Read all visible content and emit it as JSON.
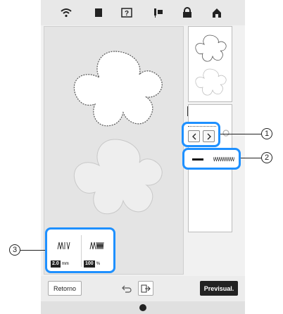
{
  "topbar": {
    "icons": [
      "wifi-icon",
      "page-icon",
      "help-icon",
      "needle-icon",
      "lock-icon",
      "home-icon"
    ]
  },
  "zoom": {
    "level_label": "100",
    "level_unit": "%"
  },
  "stitch": {
    "length_value": "2.0",
    "length_unit": "mm",
    "density_value": "100",
    "density_unit": "%"
  },
  "buttons": {
    "back_label": "Retorno",
    "preview_label": "Previsual."
  },
  "callouts": {
    "one": "1",
    "two": "2",
    "three": "3"
  },
  "colors": {
    "callout_accent": "#1e90ff"
  }
}
